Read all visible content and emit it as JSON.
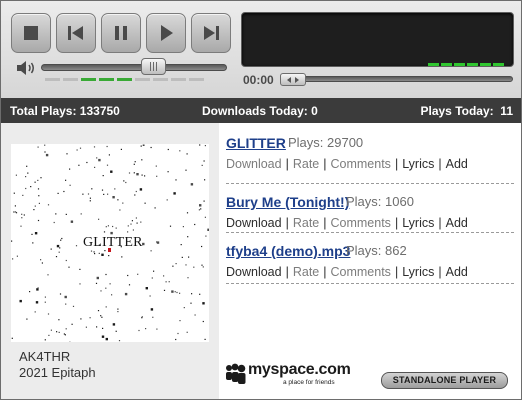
{
  "player": {
    "time": "00:00",
    "volume_level": 0.62
  },
  "stats": {
    "total_plays": "Total Plays: 133750",
    "downloads_today": "Downloads Today: 0",
    "plays_today": "Plays Today:  11"
  },
  "album": {
    "cover_text": "GLITTER",
    "artist": "AK4THR",
    "info": "2021 Epitaph"
  },
  "tracks": [
    {
      "title": "GLITTER",
      "plays": "Plays: 29700"
    },
    {
      "title": "Bury Me (Tonight!)",
      "plays": "Plays: 1060"
    },
    {
      "title": "tfyba4 (demo).mp3",
      "plays": "Plays: 862"
    }
  ],
  "actions": {
    "download": "Download",
    "rate": "Rate",
    "comments": "Comments",
    "lyrics": "Lyrics",
    "add": "Add",
    "separator": "|"
  },
  "branding": {
    "logo": "myspace.com",
    "tagline": "a place for friends",
    "standalone": "STANDALONE PLAYER"
  },
  "colors": {
    "link_blue": "#1e3f8a",
    "level_green": "#39a935",
    "stats_bar": "#3b3b3b"
  },
  "icons": [
    "stop-icon",
    "previous-icon",
    "pause-icon",
    "play-icon",
    "next-icon",
    "speaker-icon",
    "myspace-people-icon"
  ]
}
